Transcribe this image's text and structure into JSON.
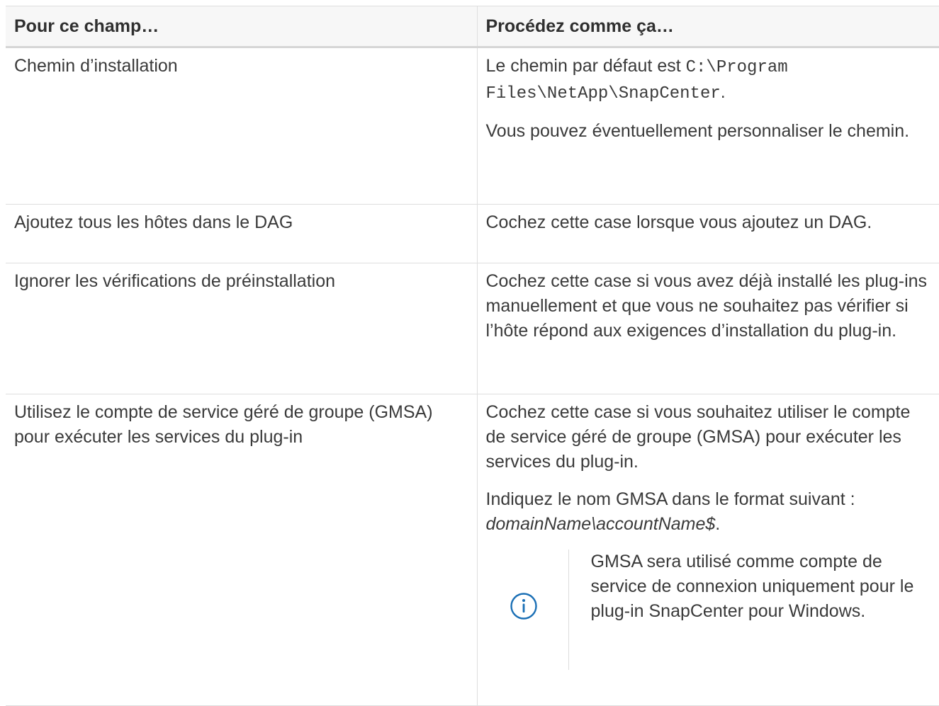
{
  "table": {
    "headers": [
      "Pour ce champ…",
      "Procédez comme ça…"
    ],
    "rows": [
      {
        "field": "Chemin d’installation",
        "desc_p1_prefix": "Le chemin par défaut est ",
        "desc_p1_code": "C:\\Program Files\\NetApp\\SnapCenter",
        "desc_p1_suffix": ".",
        "desc_p2": "Vous pouvez éventuellement personnaliser le chemin."
      },
      {
        "field": "Ajoutez tous les hôtes dans le DAG",
        "desc_p1": "Cochez cette case lorsque vous ajoutez un DAG."
      },
      {
        "field": "Ignorer les vérifications de préinstallation",
        "desc_p1": "Cochez cette case si vous avez déjà installé les plug-ins manuellement et que vous ne souhaitez pas vérifier si l’hôte répond aux exigences d’installation du plug-in."
      },
      {
        "field": "Utilisez le compte de service géré de groupe (GMSA) pour exécuter les services du plug-in",
        "desc_p1": "Cochez cette case si vous souhaitez utiliser le compte de service géré de groupe (GMSA) pour exécuter les services du plug-in.",
        "desc_p2_prefix": "Indiquez le nom GMSA dans le format suivant : ",
        "desc_p2_italic": "domainName\\accountName$",
        "desc_p2_suffix": ".",
        "note": "GMSA sera utilisé comme compte de service de connexion uniquement pour le plug-in SnapCenter pour Windows.",
        "note_icon": "info-circle-icon",
        "note_icon_color": "#1a6fb5"
      }
    ]
  }
}
